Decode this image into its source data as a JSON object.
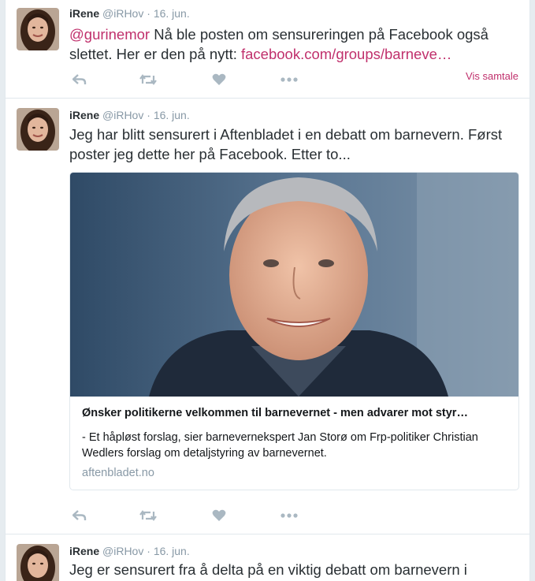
{
  "tweets": [
    {
      "name": "iRene",
      "handle": "@iRHov",
      "separator": "·",
      "date": "16. jun.",
      "mention": "@gurinemor",
      "text": " Nå ble posten om sensureringen på Facebook også slettet. Her er den på nytt: ",
      "link": "facebook.com/groups/barneve…",
      "view_conversation": "Vis samtale"
    },
    {
      "name": "iRene",
      "handle": "@iRHov",
      "separator": "·",
      "date": "16. jun.",
      "text": "Jeg har blitt sensurert i Aftenbladet i en debatt om barnevern. Først poster jeg dette her på Facebook. Etter to...",
      "card": {
        "title": "Ønsker politikerne velkommen til barnevernet - men advarer mot styr…",
        "description": "- Et håpløst forslag, sier barnevernekspert Jan Storø om Frp-politiker Christian Wedlers forslag om detaljstyring av barnevernet.",
        "domain": "aftenbladet.no"
      }
    },
    {
      "name": "iRene",
      "handle": "@iRHov",
      "separator": "·",
      "date": "16. jun.",
      "text": "Jeg er sensurert fra å delta på en viktig debatt om barnevern i"
    }
  ],
  "icons": {
    "reply": "reply-icon",
    "retweet": "retweet-icon",
    "like": "heart-icon",
    "more": "more-icon"
  },
  "colors": {
    "link": "#c0306c",
    "muted": "#8899a6",
    "icon": "#aab8c2",
    "border": "#e1e8ed"
  }
}
